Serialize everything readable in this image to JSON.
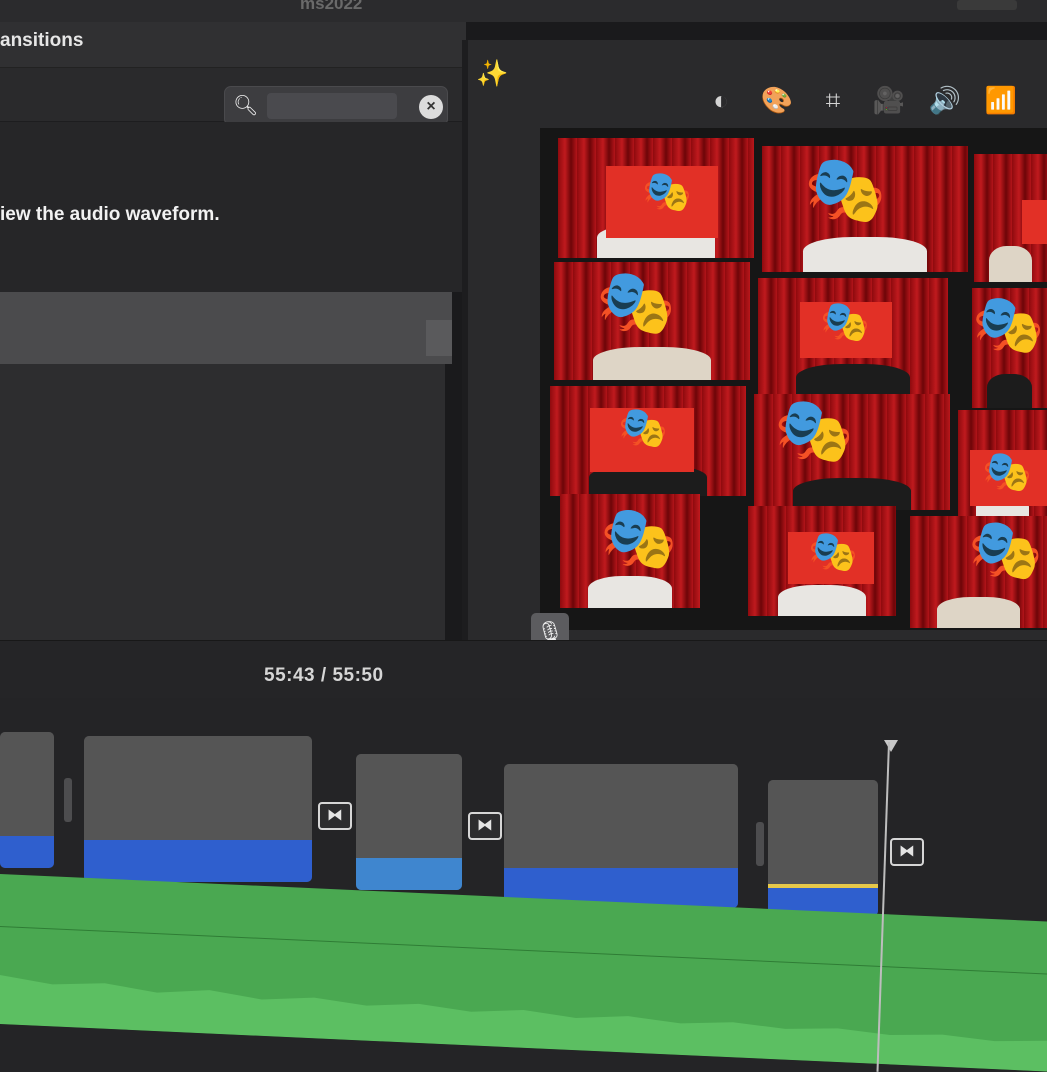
{
  "window": {
    "title": "ms2022"
  },
  "browser": {
    "tab_label": "ansitions",
    "search": {
      "value": "",
      "placeholder": ""
    },
    "hint_text": "iew the audio waveform."
  },
  "viewer": {
    "toolbar": [
      {
        "name": "color-balance-icon",
        "glyph": "◐"
      },
      {
        "name": "color-palette-icon",
        "glyph": "🎨"
      },
      {
        "name": "crop-icon",
        "glyph": "⌗"
      },
      {
        "name": "stabilization-camera-icon",
        "glyph": "🎥"
      },
      {
        "name": "volume-icon",
        "glyph": "🔊"
      },
      {
        "name": "equalizer-icon",
        "glyph": "📶"
      }
    ],
    "mask_glyph": "🎭",
    "mic_glyph": "🎙",
    "mixer_glyph": "⚟"
  },
  "timeline": {
    "current_time": "55:43",
    "separator": "/",
    "total_time": "55:50",
    "transition_glyph": "⧓"
  },
  "colors": {
    "record": "#f04a34",
    "audio_clip": "#2f5fce",
    "music_track": "#4aa851",
    "redaction_box": "#e23026"
  }
}
